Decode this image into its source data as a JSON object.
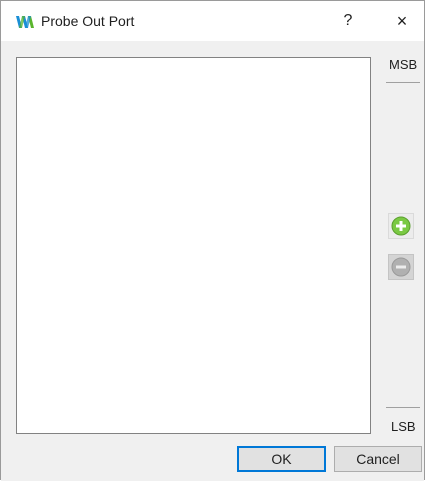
{
  "window": {
    "title": "Probe Out Port",
    "help_label": "?",
    "close_label": "×"
  },
  "side": {
    "msb_label": "MSB",
    "lsb_label": "LSB"
  },
  "buttons": {
    "ok_label": "OK",
    "cancel_label": "Cancel"
  },
  "icons": {
    "app": "gowin-logo-icon",
    "add": "plus-circle-icon",
    "remove": "minus-circle-icon"
  },
  "colors": {
    "add_green": "#7ac943",
    "remove_gray": "#b0b0b0",
    "logo_blue": "#1a8fd6",
    "logo_green": "#5ab52d",
    "ok_border": "#0078d7"
  },
  "port_list": {
    "items": []
  }
}
